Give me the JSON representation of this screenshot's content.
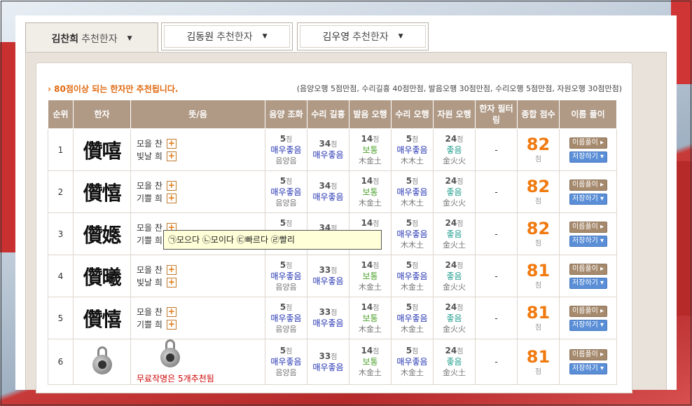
{
  "tabs": [
    {
      "name": "김찬희",
      "suffix": "추천한자",
      "active": true
    },
    {
      "name": "김동원",
      "suffix": "추천한자",
      "active": false
    },
    {
      "name": "김우영",
      "suffix": "추천한자",
      "active": false
    }
  ],
  "note": "› 80점이상 되는 한자만 추천됩니다.",
  "scoring": "(음양오행 5점만점, 수리길흉 40점만점, 발음오행 30점만점, 수리오행 5점만점, 자원오행 30점만점)",
  "headers": [
    "순위",
    "한자",
    "뜻/음",
    "음양 조화",
    "수리 길흉",
    "발음 오행",
    "수리 오행",
    "자원 오행",
    "한자 필터링",
    "종합 점수",
    "이름 풀이"
  ],
  "buttons": {
    "interpret": "이름풀이 ▸",
    "save": "저장하기 ▾"
  },
  "point_unit": "점",
  "rows": [
    {
      "rank": "1",
      "hanja": "儹嘻",
      "m1": "모을 찬",
      "m2": "빛날 희",
      "yy": [
        "5",
        "매우좋음",
        "음양음"
      ],
      "sl": [
        "34",
        "매우좋음"
      ],
      "bo": [
        "14",
        "보통",
        "木金土"
      ],
      "so": [
        "5",
        "매우좋음",
        "木木土"
      ],
      "jo": [
        "24",
        "좋음",
        "金火火"
      ],
      "filter": "-",
      "total": "82"
    },
    {
      "rank": "2",
      "hanja": "儹憘",
      "m1": "모을 찬",
      "m2": "기쁠 희",
      "yy": [
        "5",
        "매우좋음",
        "음양음"
      ],
      "sl": [
        "34",
        "매우좋음"
      ],
      "bo": [
        "14",
        "보통",
        "木金土"
      ],
      "so": [
        "5",
        "매우좋음",
        "木木土"
      ],
      "jo": [
        "24",
        "좋음",
        "金火火"
      ],
      "filter": "-",
      "total": "82"
    },
    {
      "rank": "3",
      "hanja": "儹嫕",
      "m1": "모을 찬",
      "m2": "기쁠 희",
      "yy": [
        "5",
        "매우좋음",
        "음양음"
      ],
      "sl": [
        "34",
        "매우좋음"
      ],
      "bo": [
        "14",
        "보통",
        "木金土"
      ],
      "so": [
        "5",
        "매우좋음",
        "木木土"
      ],
      "jo": [
        "24",
        "좋음",
        "金火土"
      ],
      "filter": "-",
      "total": "82"
    },
    {
      "rank": "4",
      "hanja": "儹曦",
      "m1": "모을 찬",
      "m2": "빛날 희",
      "yy": [
        "5",
        "매우좋음",
        "음양음"
      ],
      "sl": [
        "33",
        "매우좋음"
      ],
      "bo": [
        "14",
        "보통",
        "木金土"
      ],
      "so": [
        "5",
        "매우좋음",
        "木金土"
      ],
      "jo": [
        "24",
        "좋음",
        "金火火"
      ],
      "filter": "-",
      "total": "81"
    },
    {
      "rank": "5",
      "hanja": "儹憘",
      "m1": "모을 찬",
      "m2": "기쁠 희",
      "yy": [
        "5",
        "매우좋음",
        "음양음"
      ],
      "sl": [
        "33",
        "매우좋음"
      ],
      "bo": [
        "14",
        "보통",
        "木金土"
      ],
      "so": [
        "5",
        "매우좋음",
        "木金土"
      ],
      "jo": [
        "24",
        "좋음",
        "金火火"
      ],
      "filter": "-",
      "total": "81"
    },
    {
      "rank": "6",
      "locked": true,
      "free_note": "무료작명은 5개추천됨",
      "yy": [
        "5",
        "매우좋음",
        "음양음"
      ],
      "sl": [
        "33",
        "매우좋음"
      ],
      "bo": [
        "14",
        "보통",
        "木金土"
      ],
      "so": [
        "5",
        "매우좋음",
        "木金土"
      ],
      "jo": [
        "24",
        "좋음",
        "金火土"
      ],
      "filter": "-",
      "total": "81"
    }
  ],
  "tooltip": "㉠모으다 ㉡모이다 ㉢빠르다 ㉣빨리",
  "colors": {
    "header": "#b09a86",
    "accent": "#f07a10",
    "blue": "#2030b0",
    "green": "#4aa02a",
    "teal": "#1a9a8a"
  }
}
